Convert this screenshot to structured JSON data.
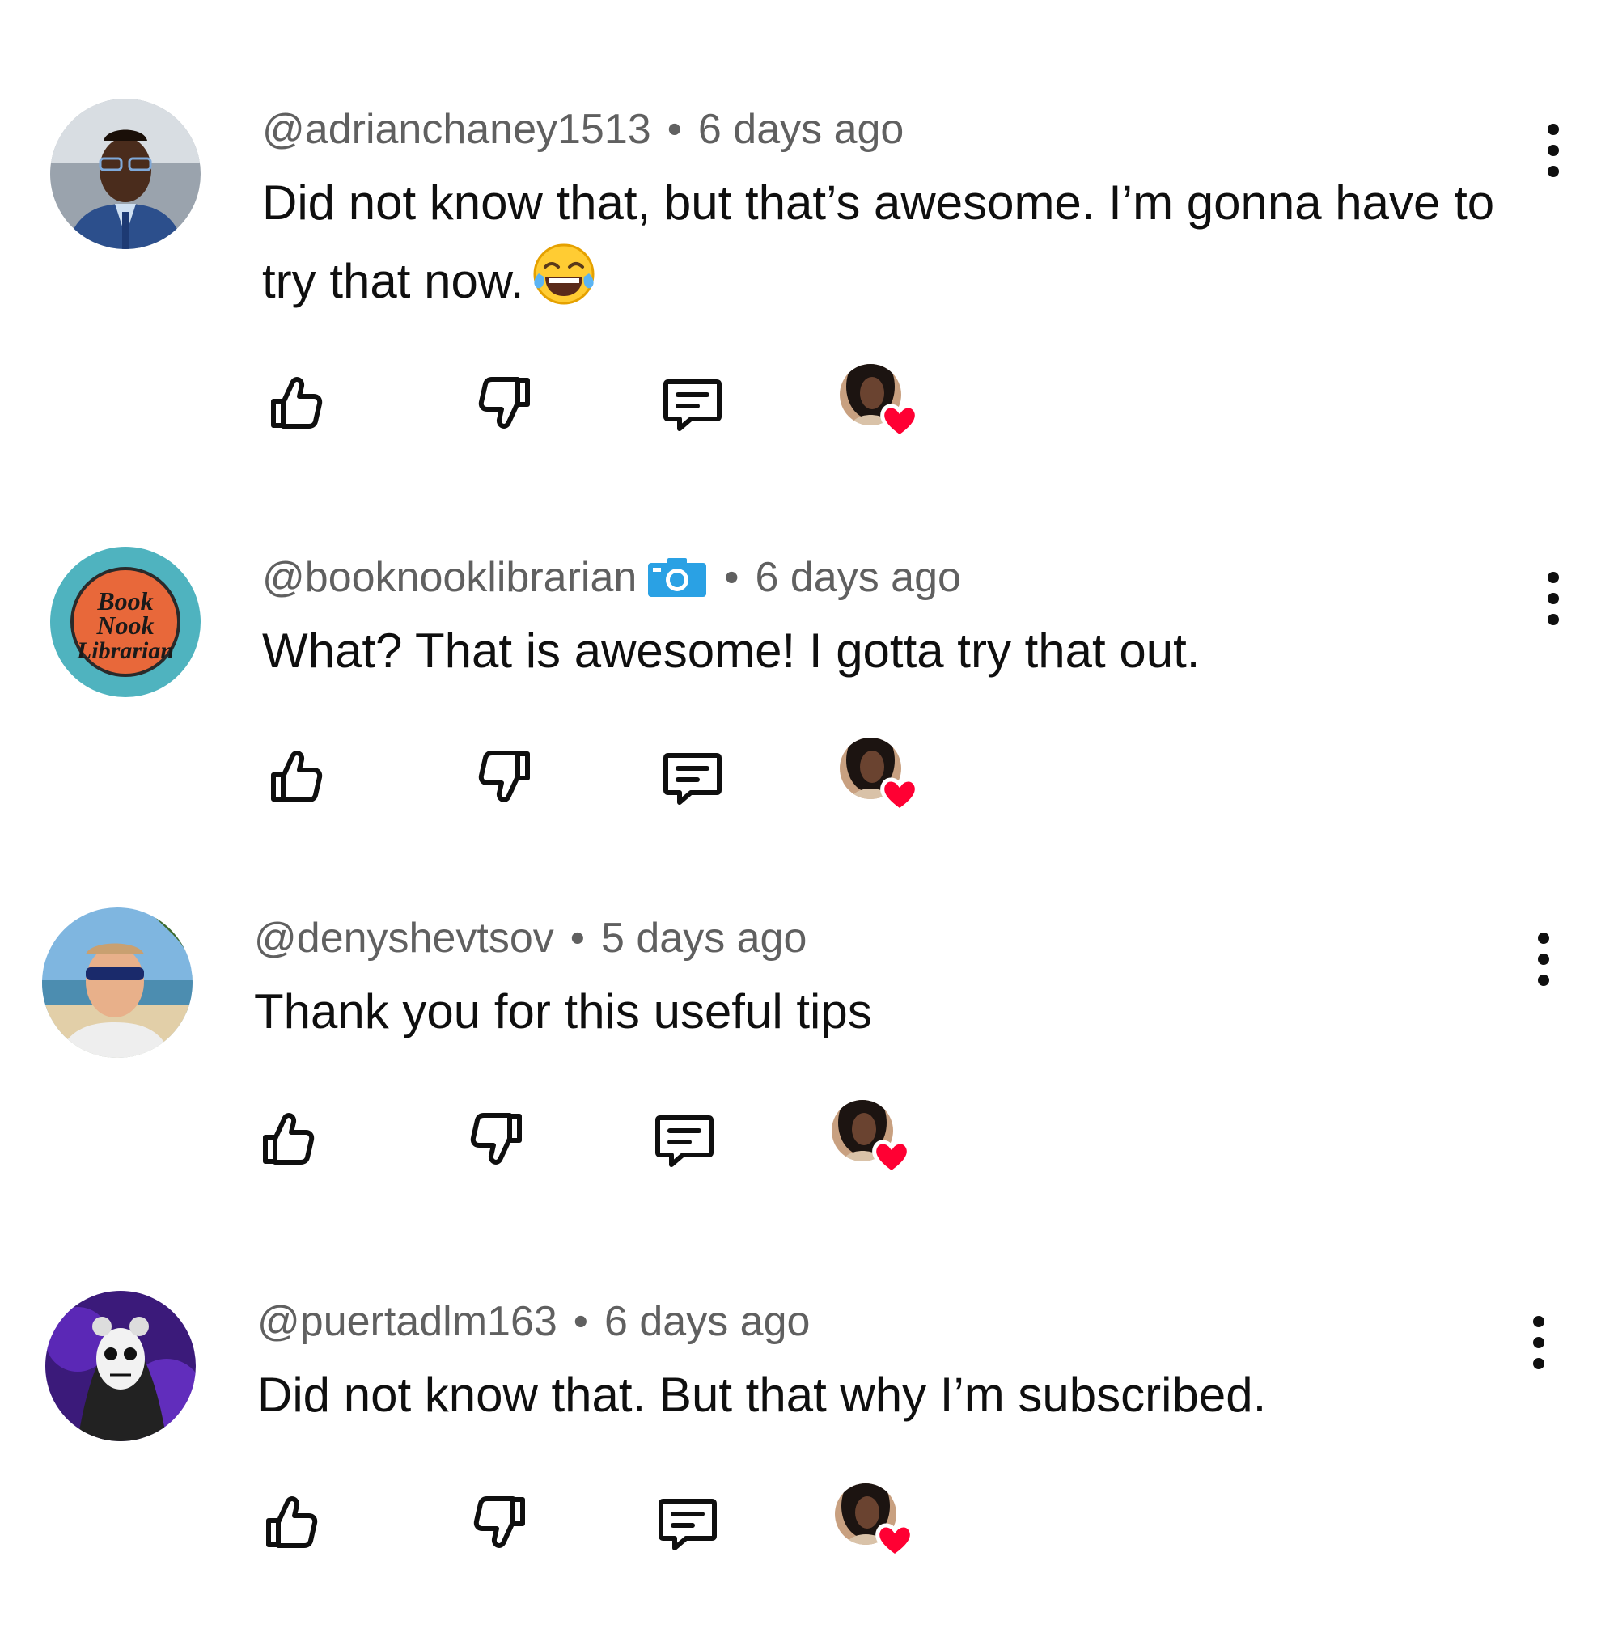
{
  "comments": [
    {
      "handle": "@adrianchaney1513",
      "separator": "•",
      "time": "6 days ago",
      "text": "Did not know that, but that’s awesome. I’m gonna have to try that now.",
      "emoji": "face-with-tears-of-joy",
      "has_badge": false
    },
    {
      "handle": "@booknooklibrarian",
      "separator": "•",
      "time": "6 days ago",
      "text": "What? That is awesome! I gotta try that out.",
      "badge_icon": "camera-icon",
      "has_badge": true,
      "avatar_text": [
        "Book",
        "Nook",
        "Librarian"
      ]
    },
    {
      "handle": "@denyshevtsov",
      "separator": "•",
      "time": "5 days ago",
      "text": "Thank you for this useful tips",
      "has_badge": false
    },
    {
      "handle": "@puertadlm163",
      "separator": "•",
      "time": "6 days ago",
      "text": "Did not know that. But that why I’m subscribed.",
      "has_badge": false
    }
  ],
  "icons": {
    "like": "thumbs-up-icon",
    "dislike": "thumbs-down-icon",
    "reply": "reply-comment-icon",
    "creator_heart": "creator-heart-icon",
    "menu": "more-vertical-icon"
  },
  "colors": {
    "meta_text": "#606060",
    "body_text": "#0f0f0f",
    "heart": "#ff0033",
    "badge_blue": "#2aa1e4"
  }
}
